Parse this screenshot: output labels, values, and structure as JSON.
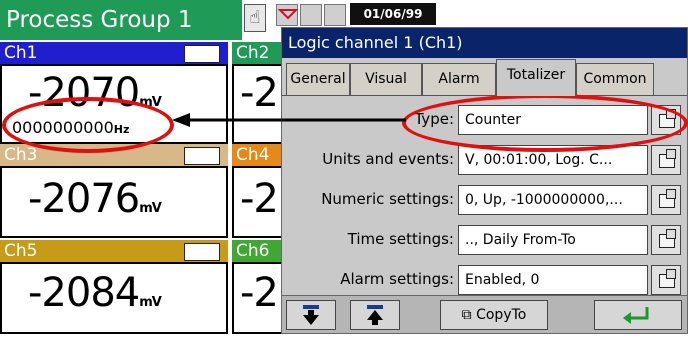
{
  "group": {
    "title": "Process Group 1"
  },
  "status": {
    "date": "01/06/99"
  },
  "channels": [
    {
      "name": "Ch1",
      "value": "-2070",
      "unit": "mV",
      "counter": "0000000000",
      "counter_unit": "Hz",
      "header_color": "#1f1fd0"
    },
    {
      "name": "Ch2",
      "value": "-2",
      "header_color": "#1f9a57"
    },
    {
      "name": "Ch3",
      "value": "-2076",
      "unit": "mV",
      "header_color": "#d8b888"
    },
    {
      "name": "Ch4",
      "value": "-2",
      "header_color": "#e58a1a"
    },
    {
      "name": "Ch5",
      "value": "-2084",
      "unit": "mV",
      "header_color": "#c89a1a"
    },
    {
      "name": "Ch6",
      "value": "-2",
      "header_color": "#3fa832"
    }
  ],
  "dialog": {
    "title": "Logic channel 1 (Ch1)",
    "tabs": [
      "General",
      "Visual",
      "Alarm",
      "Totalizer",
      "Common"
    ],
    "active_tab": "Totalizer",
    "fields": [
      {
        "label": "Type:",
        "value": "Counter"
      },
      {
        "label": "Units and events:",
        "value": "V, 00:01:00, Log. C..."
      },
      {
        "label": "Numeric settings:",
        "value": "0, Up, -1000000000,..."
      },
      {
        "label": "Time settings:",
        "value": ".., Daily From-To"
      },
      {
        "label": "Alarm settings:",
        "value": "Enabled, 0"
      }
    ],
    "buttons": {
      "copy_to": "CopyTo"
    }
  },
  "colors": {
    "group_bar": "#1f9a57",
    "dialog_title": "#0a246a",
    "highlight": "#e01010"
  }
}
